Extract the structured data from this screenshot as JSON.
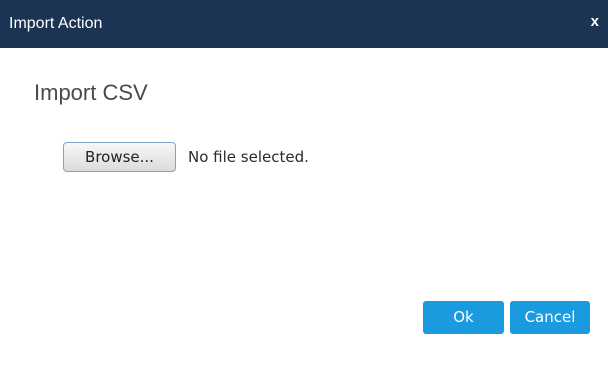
{
  "dialog": {
    "title": "Import Action",
    "close_label": "x"
  },
  "main": {
    "section_title": "Import CSV",
    "file_input": {
      "browse_label": "Browse...",
      "status_text": "No file selected."
    }
  },
  "footer": {
    "ok_label": "Ok",
    "cancel_label": "Cancel"
  },
  "colors": {
    "titlebar": "#1b3454",
    "primary_button": "#1a9be0"
  }
}
